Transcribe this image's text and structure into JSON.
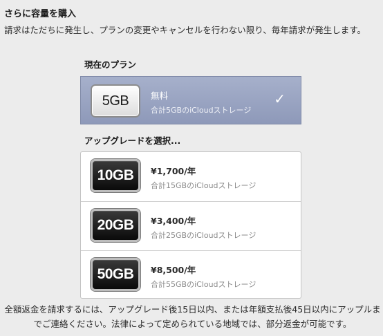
{
  "header": {
    "title": "さらに容量を購入",
    "intro": "請求はただちに発生し、プランの変更やキャンセルを行わない限り、毎年請求が発生します。"
  },
  "current_plan": {
    "label": "現在のプラン",
    "capacity": "5GB",
    "price": "無料",
    "description": "合計5GBのiCloudストレージ",
    "selected": true,
    "checkmark_icon": "checkmark-icon"
  },
  "upgrade": {
    "label": "アップグレードを選択...",
    "plans": [
      {
        "capacity": "10GB",
        "price": "¥1,700/年",
        "description": "合計15GBのiCloudストレージ"
      },
      {
        "capacity": "20GB",
        "price": "¥3,400/年",
        "description": "合計25GBのiCloudストレージ"
      },
      {
        "capacity": "50GB",
        "price": "¥8,500/年",
        "description": "合計55GBのiCloudストレージ"
      }
    ]
  },
  "footer": {
    "note": "全額返金を請求するには、アップグレード後15日以内、または年額支払後45日以内にアップルまでご連絡ください。法律によって定められている地域では、部分返金が可能です。"
  },
  "colors": {
    "selected_row": "#9aa4c2",
    "background": "#ececec"
  }
}
